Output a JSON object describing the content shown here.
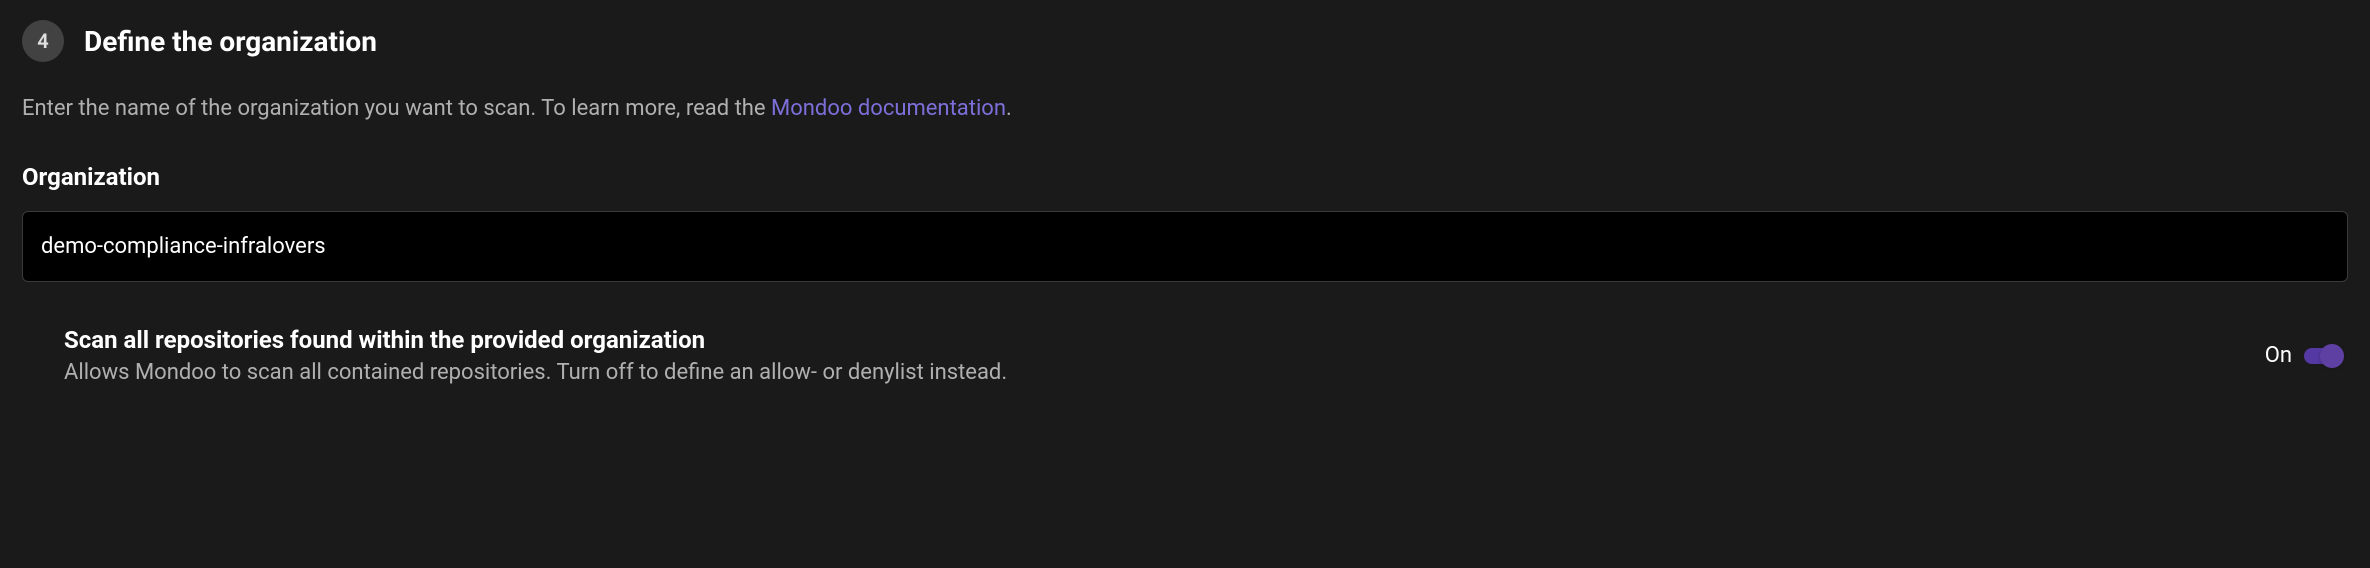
{
  "step": {
    "number": "4",
    "title": "Define the organization"
  },
  "description": {
    "text_before": "Enter the name of the organization you want to scan. To learn more, read the ",
    "link_text": "Mondoo documentation",
    "text_after": "."
  },
  "organization": {
    "label": "Organization",
    "value": "demo-compliance-infralovers"
  },
  "toggle": {
    "title": "Scan all repositories found within the provided organization",
    "subtitle": "Allows Mondoo to scan all contained repositories. Turn off to define an allow- or denylist instead.",
    "state_label": "On",
    "enabled": true
  }
}
